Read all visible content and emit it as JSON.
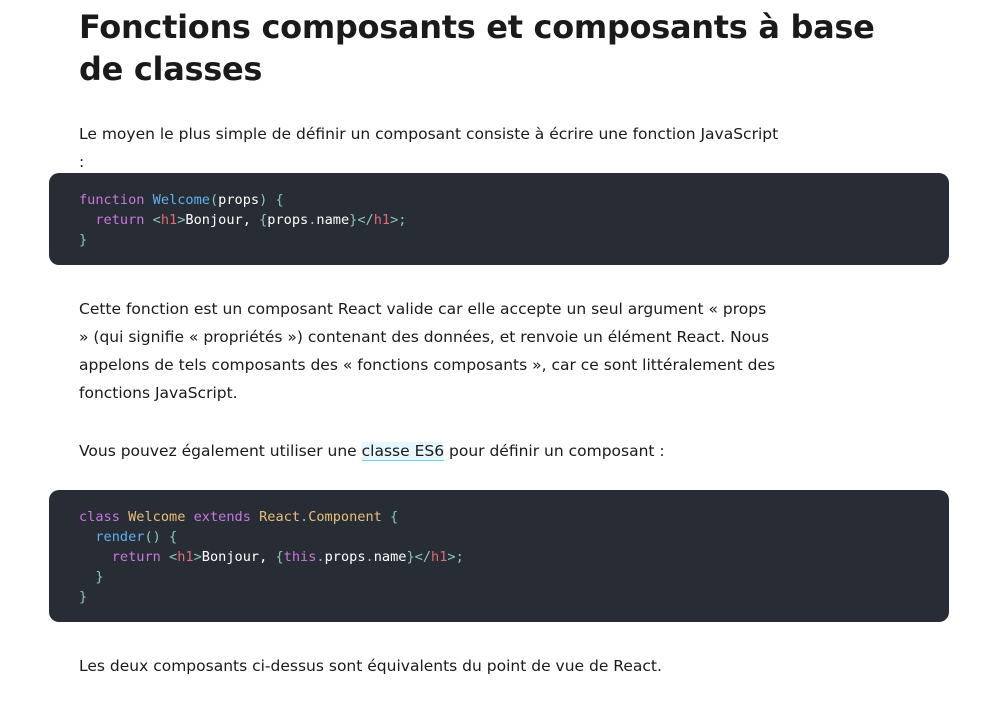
{
  "title": "Fonctions composants et composants à base de classes",
  "paragraphs": {
    "intro": "Le moyen le plus simple de définir un composant consiste à écrire une fonction JavaScript :",
    "explanation": "Cette fonction est un composant React valide car elle accepte un seul argument « props » (qui signifie « propriétés ») contenant des données, et renvoie un élément React. Nous appelons de tels composants des « fonctions composants », car ce sont littéralement des fonctions JavaScript.",
    "class_intro_before": "Vous pouvez également utiliser une ",
    "class_intro_link": "classe ES6",
    "class_intro_after": " pour définir un composant :",
    "conclusion": "Les deux composants ci-dessus sont équivalents du point de vue de React."
  },
  "code_function": {
    "l1_kw": "function",
    "l1_fn": "Welcome",
    "l1_open": "(",
    "l1_param": "props",
    "l1_close": ") {",
    "l2_kw": "return",
    "l2_lt": "<",
    "l2_tag": "h1",
    "l2_gt": ">",
    "l2_text": "Bonjour, ",
    "l2_ob": "{",
    "l2_obj": "props",
    "l2_dot": ".",
    "l2_prop": "name",
    "l2_cb": "}",
    "l2_clt": "</",
    "l2_ctag": "h1",
    "l2_cgt": ">;",
    "l3": "}"
  },
  "code_class": {
    "l1_kw": "class",
    "l1_name": "Welcome",
    "l1_ext": "extends",
    "l1_base": "React",
    "l1_dot": ".",
    "l1_comp": "Component",
    "l1_brace": "{",
    "l2_fn": "render",
    "l2_rest": "() {",
    "l3_kw": "return",
    "l3_lt": "<",
    "l3_tag": "h1",
    "l3_gt": ">",
    "l3_text": "Bonjour, ",
    "l3_ob": "{",
    "l3_this": "this",
    "l3_dot1": ".",
    "l3_props": "props",
    "l3_dot2": ".",
    "l3_name": "name",
    "l3_cb": "}",
    "l3_clt": "</",
    "l3_ctag": "h1",
    "l3_cgt": ">;",
    "l4": "}",
    "l5": "}"
  }
}
